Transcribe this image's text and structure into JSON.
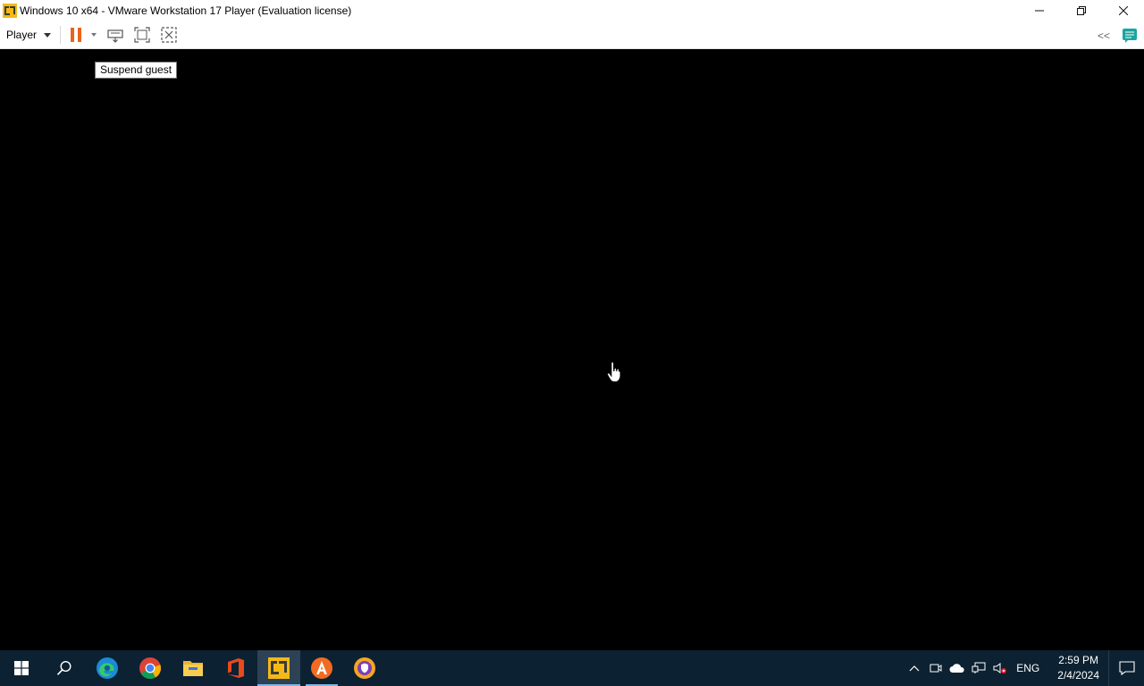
{
  "window": {
    "title": "Windows 10 x64 - VMware Workstation 17 Player (Evaluation license)",
    "minimize_icon": "minimize-icon",
    "restore_icon": "restore-icon",
    "close_icon": "close-icon"
  },
  "toolbar": {
    "player_label": "Player",
    "buttons": [
      {
        "name": "pause-icon",
        "color": "#e8641c"
      },
      {
        "name": "send-ctrl-alt-del-icon"
      },
      {
        "name": "full-screen-icon"
      },
      {
        "name": "unity-icon"
      }
    ],
    "collapse_label": "<<",
    "message_log_icon": "message-log-icon"
  },
  "tooltip": {
    "text": "Suspend guest"
  },
  "taskbar": {
    "apps": [
      {
        "name": "start-button",
        "icon": "windows-logo-icon"
      },
      {
        "name": "search-button",
        "icon": "search-icon"
      },
      {
        "name": "edge",
        "icon": "edge-icon"
      },
      {
        "name": "chrome",
        "icon": "chrome-icon"
      },
      {
        "name": "file-explorer",
        "icon": "folder-icon"
      },
      {
        "name": "office",
        "icon": "office-icon"
      },
      {
        "name": "vmware-player",
        "icon": "vmware-icon",
        "active": true
      },
      {
        "name": "avast",
        "icon": "avast-icon",
        "running": true
      },
      {
        "name": "avast-secure-browser",
        "icon": "secure-browser-icon"
      }
    ],
    "tray": {
      "language": "ENG",
      "time": "2:59 PM",
      "date": "2/4/2024"
    }
  },
  "colors": {
    "taskbar_bg": "#0c2131",
    "accent": "#e8641c"
  }
}
